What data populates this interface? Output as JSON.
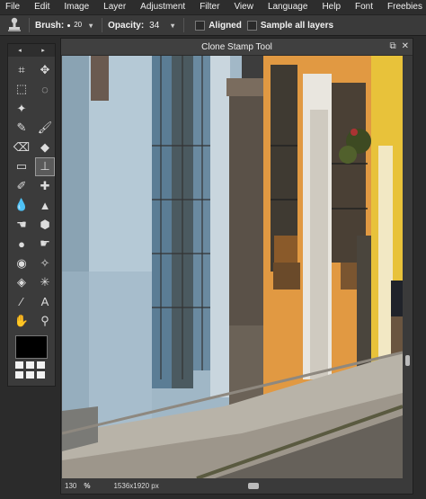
{
  "menu": {
    "items": [
      "File",
      "Edit",
      "Image",
      "Layer",
      "Adjustment",
      "Filter",
      "View",
      "Language",
      "Help",
      "Font",
      "Freebies"
    ]
  },
  "options_bar": {
    "brush_label": "Brush:",
    "brush_size": "20",
    "opacity_label": "Opacity:",
    "opacity_value": "34",
    "aligned_label": "Aligned",
    "sample_all_layers_label": "Sample all layers"
  },
  "tools_panel": {
    "nav_left": "◂",
    "nav_right": "▸",
    "tools": [
      {
        "name": "crop-icon",
        "glyph": "⌗"
      },
      {
        "name": "move-icon",
        "glyph": "✥"
      },
      {
        "name": "marquee-icon",
        "glyph": "⬚"
      },
      {
        "name": "lasso-icon",
        "glyph": "◌"
      },
      {
        "name": "magic-wand-icon",
        "glyph": "✦"
      },
      {
        "name": "blank-icon",
        "glyph": ""
      },
      {
        "name": "pencil-icon",
        "glyph": "✎"
      },
      {
        "name": "brush-icon",
        "glyph": "🖌"
      },
      {
        "name": "eraser-icon",
        "glyph": "⌫"
      },
      {
        "name": "paint-bucket-icon",
        "glyph": "◆"
      },
      {
        "name": "gradient-icon",
        "glyph": "▭"
      },
      {
        "name": "clone-stamp-icon",
        "glyph": "⊥",
        "selected": true
      },
      {
        "name": "color-replace-icon",
        "glyph": "✐"
      },
      {
        "name": "heal-icon",
        "glyph": "✚"
      },
      {
        "name": "blur-icon",
        "glyph": "💧"
      },
      {
        "name": "sharpen-icon",
        "glyph": "▲"
      },
      {
        "name": "smudge-icon",
        "glyph": "☚"
      },
      {
        "name": "sponge-icon",
        "glyph": "⬢"
      },
      {
        "name": "dodge-icon",
        "glyph": "●"
      },
      {
        "name": "burn-icon",
        "glyph": "☛"
      },
      {
        "name": "red-eye-icon",
        "glyph": "◉"
      },
      {
        "name": "spot-heal-icon",
        "glyph": "✧"
      },
      {
        "name": "bloat-icon",
        "glyph": "◈"
      },
      {
        "name": "pinch-icon",
        "glyph": "✳"
      },
      {
        "name": "color-picker-icon",
        "glyph": "⁄"
      },
      {
        "name": "type-icon",
        "glyph": "A"
      },
      {
        "name": "hand-icon",
        "glyph": "✋"
      },
      {
        "name": "zoom-icon",
        "glyph": "⚲"
      }
    ],
    "primary_color": "#000000"
  },
  "document": {
    "title": "Clone Stamp Tool",
    "zoom": "130",
    "zoom_unit": "%",
    "dimensions": "1536x1920 px"
  }
}
